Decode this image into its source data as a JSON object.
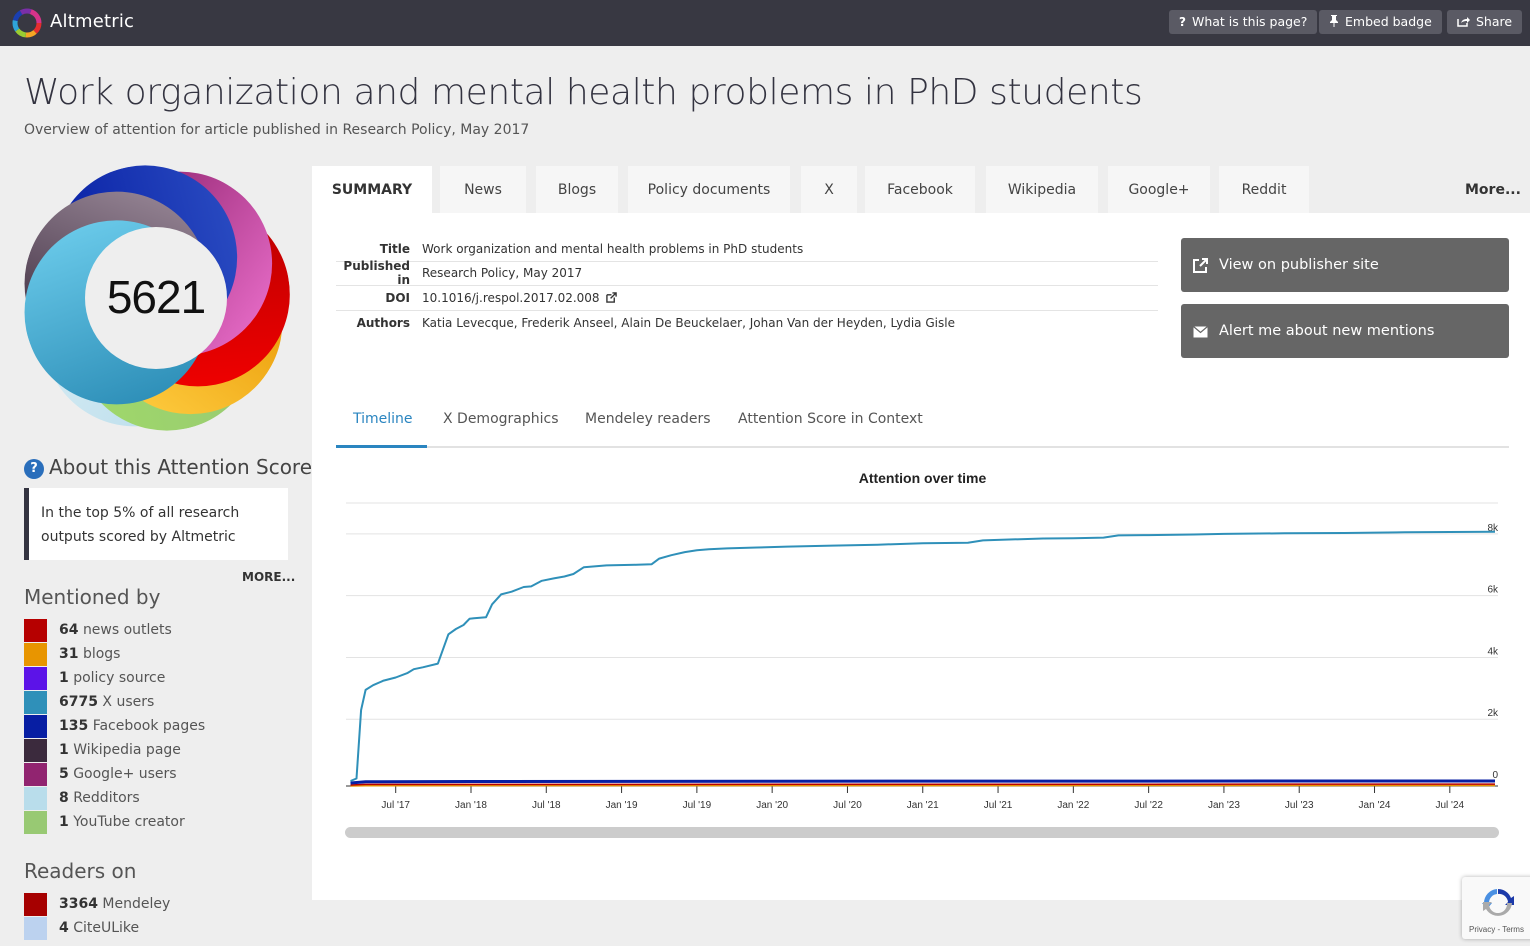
{
  "topbar": {
    "brand": "Altmetric",
    "buttons": [
      {
        "label": "What is this page?",
        "icon": "question-icon"
      },
      {
        "label": "Embed badge",
        "icon": "pin-icon"
      },
      {
        "label": "Share",
        "icon": "share-icon"
      }
    ]
  },
  "header": {
    "title": "Work organization and mental health problems in PhD students",
    "subtitle": "Overview of attention for article published in Research Policy, May 2017"
  },
  "score": {
    "value": "5621",
    "about_heading": "About this Attention Score",
    "about_text": "In the top 5% of all research outputs scored by Altmetric",
    "more_label": "MORE..."
  },
  "mentioned_by": {
    "heading": "Mentioned by",
    "items": [
      {
        "count": "64",
        "label": "news outlets",
        "color": "#b60000"
      },
      {
        "count": "31",
        "label": "blogs",
        "color": "#e89500"
      },
      {
        "count": "1",
        "label": "policy source",
        "color": "#5c13e8"
      },
      {
        "count": "6775",
        "label": "X users",
        "color": "#2f90b9"
      },
      {
        "count": "135",
        "label": "Facebook pages",
        "color": "#071ea3"
      },
      {
        "count": "1",
        "label": "Wikipedia page",
        "color": "#3b2a3d"
      },
      {
        "count": "5",
        "label": "Google+ users",
        "color": "#912470"
      },
      {
        "count": "8",
        "label": "Redditors",
        "color": "#b9ddeb"
      },
      {
        "count": "1",
        "label": "YouTube creator",
        "color": "#98c973"
      }
    ]
  },
  "readers_on": {
    "heading": "Readers on",
    "items": [
      {
        "count": "3364",
        "label": "Mendeley",
        "color": "#a60000"
      },
      {
        "count": "4",
        "label": "CiteULike",
        "color": "#bcd2ef"
      }
    ]
  },
  "tabs": {
    "items": [
      "SUMMARY",
      "News",
      "Blogs",
      "Policy documents",
      "X",
      "Facebook",
      "Wikipedia",
      "Google+",
      "Reddit"
    ],
    "active": "SUMMARY",
    "more_label": "More..."
  },
  "meta": {
    "rows": [
      {
        "key": "Title",
        "value": "Work organization and mental health problems in PhD students"
      },
      {
        "key": "Published in",
        "value": "Research Policy, May 2017"
      },
      {
        "key": "DOI",
        "value": "10.1016/j.respol.2017.02.008"
      },
      {
        "key": "Authors",
        "value": "Katia Levecque, Frederik Anseel, Alain De Beuckelaer, Johan Van der Heyden, Lydia Gisle"
      }
    ]
  },
  "actions": {
    "publisher_label": "View on publisher site",
    "alert_label": "Alert me about new mentions"
  },
  "subtabs": {
    "items": [
      "Timeline",
      "X Demographics",
      "Mendeley readers",
      "Attention Score in Context"
    ],
    "active": "Timeline"
  },
  "recaptcha": {
    "text": "Privacy - Terms"
  },
  "chart_data": {
    "type": "line",
    "title": "Attention over time",
    "xlabel": "",
    "ylabel": "",
    "x_ticks": [
      "Jul '17",
      "Jan '18",
      "Jul '18",
      "Jan '19",
      "Jul '19",
      "Jan '20",
      "Jul '20",
      "Jan '21",
      "Jul '21",
      "Jan '22",
      "Jul '22",
      "Jan '23",
      "Jul '23",
      "Jan '24",
      "Jul '24"
    ],
    "y_ticks": [
      "0",
      "2k",
      "4k",
      "6k",
      "8k"
    ],
    "ylim": [
      0,
      8000
    ],
    "x_range": [
      "2017-03",
      "2024-10"
    ],
    "grid": true,
    "series": [
      {
        "name": "X users",
        "color": "#2f90b9",
        "x": [
          2017.2,
          2017.24,
          2017.27,
          2017.3,
          2017.35,
          2017.42,
          2017.5,
          2017.58,
          2017.62,
          2017.68,
          2017.78,
          2017.85,
          2017.9,
          2017.95,
          2017.99,
          2018.02,
          2018.1,
          2018.14,
          2018.2,
          2018.27,
          2018.35,
          2018.4,
          2018.47,
          2018.55,
          2018.62,
          2018.68,
          2018.75,
          2018.9,
          2019.1,
          2019.2,
          2019.25,
          2019.33,
          2019.42,
          2019.5,
          2019.58,
          2019.7,
          2019.9,
          2020.1,
          2020.4,
          2020.7,
          2021.0,
          2021.3,
          2021.4,
          2021.6,
          2021.8,
          2022.0,
          2022.2,
          2022.3,
          2022.5,
          2022.8,
          2023.0,
          2023.4,
          2023.8,
          2024.2,
          2024.5,
          2024.8
        ],
        "values": [
          0,
          80,
          2300,
          2950,
          3100,
          3250,
          3350,
          3500,
          3620,
          3680,
          3800,
          4750,
          4920,
          5050,
          5250,
          5270,
          5300,
          5720,
          6040,
          6130,
          6280,
          6300,
          6480,
          6560,
          6620,
          6700,
          6920,
          6980,
          7000,
          7020,
          7200,
          7310,
          7410,
          7470,
          7500,
          7530,
          7560,
          7590,
          7620,
          7650,
          7700,
          7710,
          7790,
          7820,
          7850,
          7860,
          7880,
          7950,
          7960,
          7980,
          8000,
          8020,
          8030,
          8050,
          8060,
          8070
        ]
      },
      {
        "name": "Facebook pages",
        "color": "#071ea3",
        "x": [
          2017.2,
          2017.3,
          2018.0,
          2020.0,
          2024.8
        ],
        "values": [
          0,
          80,
          100,
          120,
          135
        ]
      },
      {
        "name": "News outlets",
        "color": "#b60000",
        "x": [
          2017.2,
          2017.3,
          2024.8
        ],
        "values": [
          0,
          40,
          64
        ]
      },
      {
        "name": "Blogs",
        "color": "#e89500",
        "x": [
          2017.2,
          2017.3,
          2024.8
        ],
        "values": [
          0,
          20,
          31
        ]
      }
    ]
  }
}
